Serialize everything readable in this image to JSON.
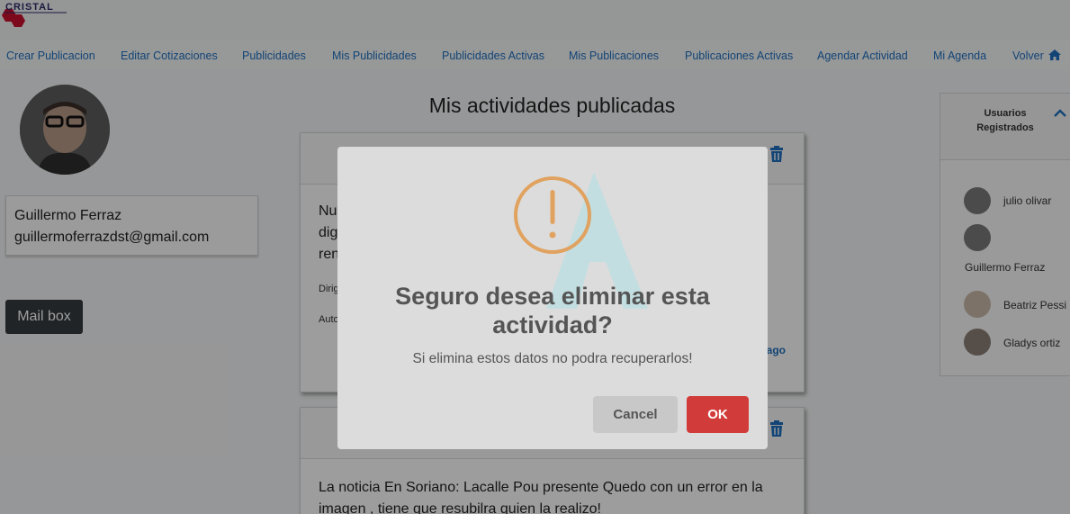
{
  "logo": {
    "text": "CRISTAL"
  },
  "nav": {
    "items": [
      "Crear Publicacion",
      "Editar Cotizaciones",
      "Publicidades",
      "Mis Publicidades",
      "Publicidades Activas",
      "Mis Publicaciones",
      "Publicaciones Activas",
      "Agendar Actividad",
      "Mi Agenda",
      "Volver"
    ],
    "volver_icon": "home-icon"
  },
  "profile": {
    "name": "Guillermo Ferraz",
    "email": "guillermoferrazdst@gmail.com",
    "mailbox_label": "Mail box"
  },
  "main": {
    "title": "Mis actividades publicadas",
    "card1": {
      "line1": "Nu",
      "line2": "dig",
      "line3": "ren",
      "label1": "Dirig",
      "label2": "Auto",
      "link": "ago"
    },
    "card2": {
      "text": "La noticia En Soriano: Lacalle Pou presente Quedo con un error en la imagen , tiene que resubilra quien la realizo!"
    }
  },
  "users_panel": {
    "title": "Usuarios Registrados",
    "users": [
      "julio olivar",
      "Guillermo Ferraz",
      "Beatriz Pessi",
      "Gladys ortiz"
    ]
  },
  "modal": {
    "icon": "warning-icon",
    "title": "Seguro desea eliminar esta actividad?",
    "text": "Si elimina estos datos no podra recuperarlos!",
    "cancel_label": "Cancel",
    "ok_label": "OK"
  },
  "colors": {
    "link": "#1d6fbd",
    "ok_button": "#d13c3a",
    "cancel_button": "#c8c8c8",
    "warning": "#e0a25e",
    "mailbox": "#343a40"
  }
}
